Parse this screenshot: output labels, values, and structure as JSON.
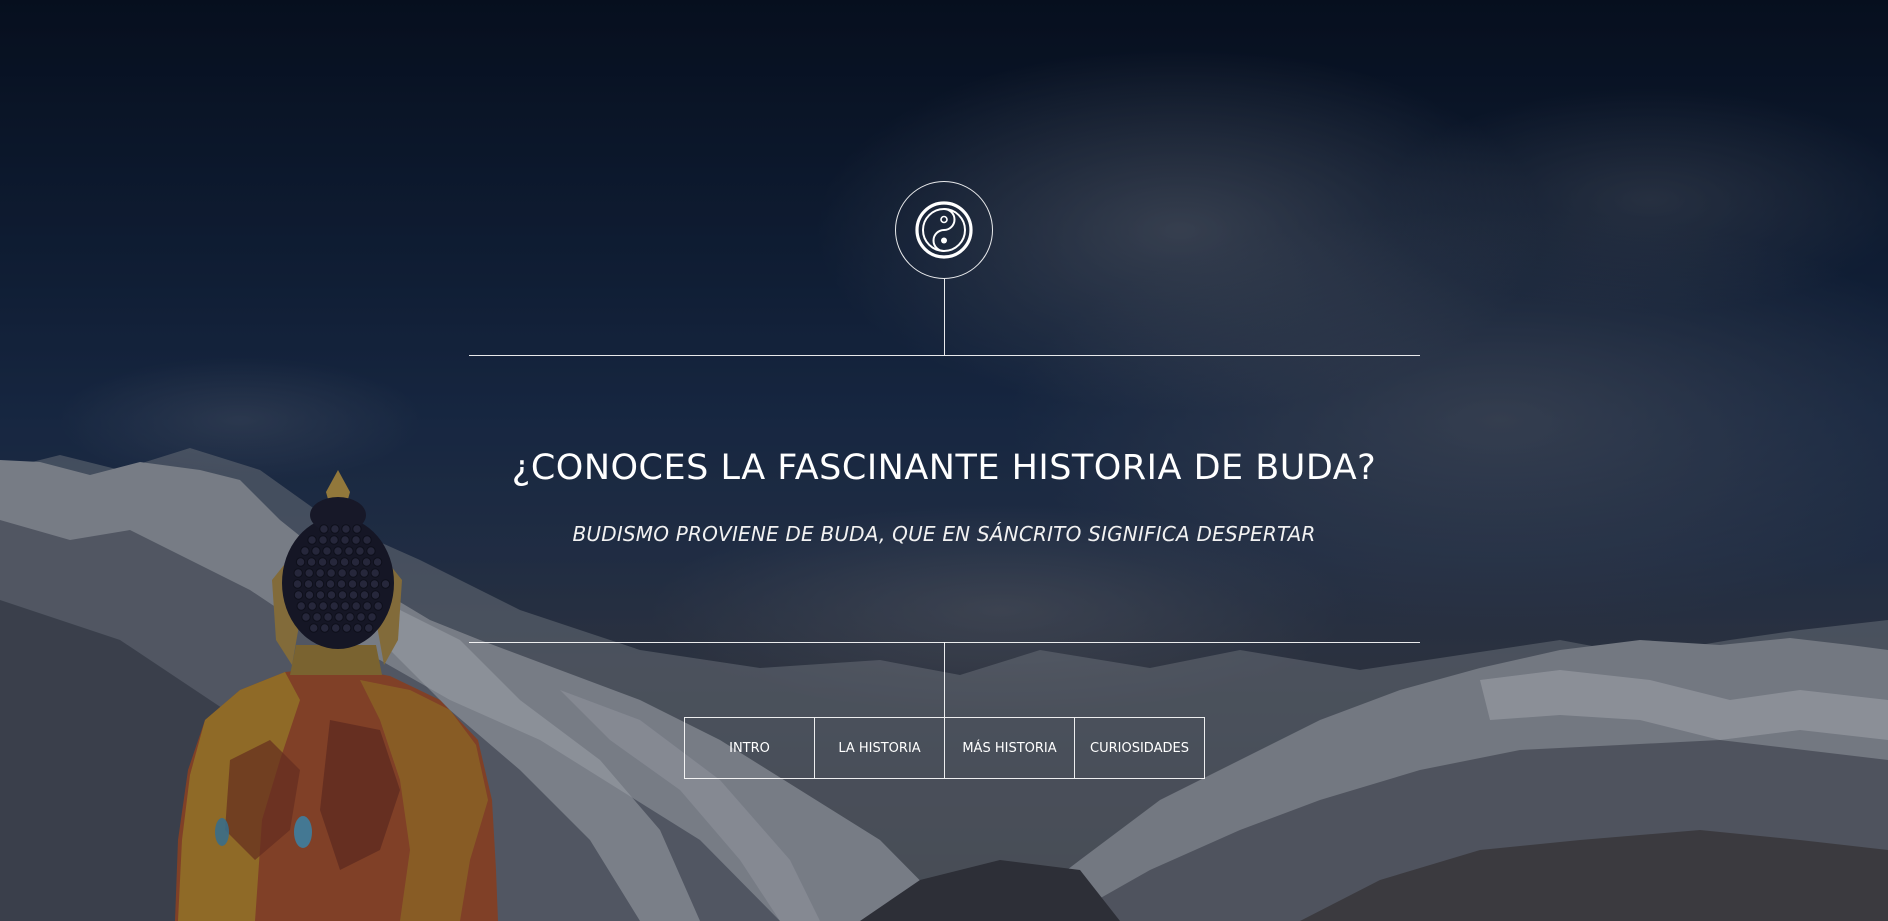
{
  "hero": {
    "emblem_icon": "yin-yang-icon",
    "title": "¿CONOCES LA FASCINANTE HISTORIA DE BUDA?",
    "subtitle": "BUDISMO PROVIENE DE BUDA, QUE EN SÁNCRITO SIGNIFICA DESPERTAR"
  },
  "nav": {
    "items": [
      {
        "label": "INTRO"
      },
      {
        "label": "LA HISTORIA"
      },
      {
        "label": "MÁS HISTORIA"
      },
      {
        "label": "CURIOSIDADES"
      }
    ]
  },
  "colors": {
    "text": "#ffffff",
    "sky_top": "#081122",
    "sky_mid": "#1f3252",
    "robe": "#b0552f",
    "robe_gold": "#c99a2e"
  }
}
